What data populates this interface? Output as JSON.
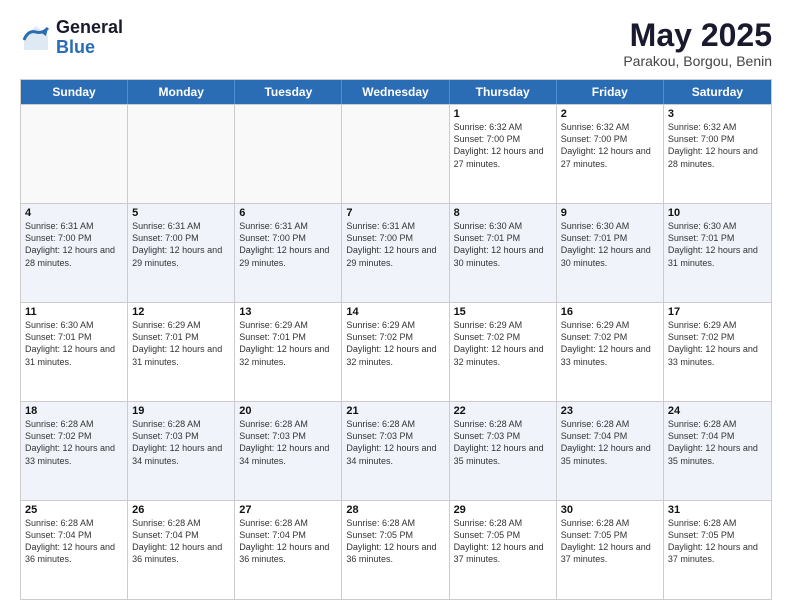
{
  "header": {
    "logo_general": "General",
    "logo_blue": "Blue",
    "month": "May 2025",
    "location": "Parakou, Borgou, Benin"
  },
  "days_of_week": [
    "Sunday",
    "Monday",
    "Tuesday",
    "Wednesday",
    "Thursday",
    "Friday",
    "Saturday"
  ],
  "rows": [
    [
      {
        "day": "",
        "text": ""
      },
      {
        "day": "",
        "text": ""
      },
      {
        "day": "",
        "text": ""
      },
      {
        "day": "",
        "text": ""
      },
      {
        "day": "1",
        "text": "Sunrise: 6:32 AM\nSunset: 7:00 PM\nDaylight: 12 hours\nand 27 minutes."
      },
      {
        "day": "2",
        "text": "Sunrise: 6:32 AM\nSunset: 7:00 PM\nDaylight: 12 hours\nand 27 minutes."
      },
      {
        "day": "3",
        "text": "Sunrise: 6:32 AM\nSunset: 7:00 PM\nDaylight: 12 hours\nand 28 minutes."
      }
    ],
    [
      {
        "day": "4",
        "text": "Sunrise: 6:31 AM\nSunset: 7:00 PM\nDaylight: 12 hours\nand 28 minutes."
      },
      {
        "day": "5",
        "text": "Sunrise: 6:31 AM\nSunset: 7:00 PM\nDaylight: 12 hours\nand 29 minutes."
      },
      {
        "day": "6",
        "text": "Sunrise: 6:31 AM\nSunset: 7:00 PM\nDaylight: 12 hours\nand 29 minutes."
      },
      {
        "day": "7",
        "text": "Sunrise: 6:31 AM\nSunset: 7:00 PM\nDaylight: 12 hours\nand 29 minutes."
      },
      {
        "day": "8",
        "text": "Sunrise: 6:30 AM\nSunset: 7:01 PM\nDaylight: 12 hours\nand 30 minutes."
      },
      {
        "day": "9",
        "text": "Sunrise: 6:30 AM\nSunset: 7:01 PM\nDaylight: 12 hours\nand 30 minutes."
      },
      {
        "day": "10",
        "text": "Sunrise: 6:30 AM\nSunset: 7:01 PM\nDaylight: 12 hours\nand 31 minutes."
      }
    ],
    [
      {
        "day": "11",
        "text": "Sunrise: 6:30 AM\nSunset: 7:01 PM\nDaylight: 12 hours\nand 31 minutes."
      },
      {
        "day": "12",
        "text": "Sunrise: 6:29 AM\nSunset: 7:01 PM\nDaylight: 12 hours\nand 31 minutes."
      },
      {
        "day": "13",
        "text": "Sunrise: 6:29 AM\nSunset: 7:01 PM\nDaylight: 12 hours\nand 32 minutes."
      },
      {
        "day": "14",
        "text": "Sunrise: 6:29 AM\nSunset: 7:02 PM\nDaylight: 12 hours\nand 32 minutes."
      },
      {
        "day": "15",
        "text": "Sunrise: 6:29 AM\nSunset: 7:02 PM\nDaylight: 12 hours\nand 32 minutes."
      },
      {
        "day": "16",
        "text": "Sunrise: 6:29 AM\nSunset: 7:02 PM\nDaylight: 12 hours\nand 33 minutes."
      },
      {
        "day": "17",
        "text": "Sunrise: 6:29 AM\nSunset: 7:02 PM\nDaylight: 12 hours\nand 33 minutes."
      }
    ],
    [
      {
        "day": "18",
        "text": "Sunrise: 6:28 AM\nSunset: 7:02 PM\nDaylight: 12 hours\nand 33 minutes."
      },
      {
        "day": "19",
        "text": "Sunrise: 6:28 AM\nSunset: 7:03 PM\nDaylight: 12 hours\nand 34 minutes."
      },
      {
        "day": "20",
        "text": "Sunrise: 6:28 AM\nSunset: 7:03 PM\nDaylight: 12 hours\nand 34 minutes."
      },
      {
        "day": "21",
        "text": "Sunrise: 6:28 AM\nSunset: 7:03 PM\nDaylight: 12 hours\nand 34 minutes."
      },
      {
        "day": "22",
        "text": "Sunrise: 6:28 AM\nSunset: 7:03 PM\nDaylight: 12 hours\nand 35 minutes."
      },
      {
        "day": "23",
        "text": "Sunrise: 6:28 AM\nSunset: 7:04 PM\nDaylight: 12 hours\nand 35 minutes."
      },
      {
        "day": "24",
        "text": "Sunrise: 6:28 AM\nSunset: 7:04 PM\nDaylight: 12 hours\nand 35 minutes."
      }
    ],
    [
      {
        "day": "25",
        "text": "Sunrise: 6:28 AM\nSunset: 7:04 PM\nDaylight: 12 hours\nand 36 minutes."
      },
      {
        "day": "26",
        "text": "Sunrise: 6:28 AM\nSunset: 7:04 PM\nDaylight: 12 hours\nand 36 minutes."
      },
      {
        "day": "27",
        "text": "Sunrise: 6:28 AM\nSunset: 7:04 PM\nDaylight: 12 hours\nand 36 minutes."
      },
      {
        "day": "28",
        "text": "Sunrise: 6:28 AM\nSunset: 7:05 PM\nDaylight: 12 hours\nand 36 minutes."
      },
      {
        "day": "29",
        "text": "Sunrise: 6:28 AM\nSunset: 7:05 PM\nDaylight: 12 hours\nand 37 minutes."
      },
      {
        "day": "30",
        "text": "Sunrise: 6:28 AM\nSunset: 7:05 PM\nDaylight: 12 hours\nand 37 minutes."
      },
      {
        "day": "31",
        "text": "Sunrise: 6:28 AM\nSunset: 7:05 PM\nDaylight: 12 hours\nand 37 minutes."
      }
    ]
  ],
  "alt_rows": [
    1,
    3
  ]
}
